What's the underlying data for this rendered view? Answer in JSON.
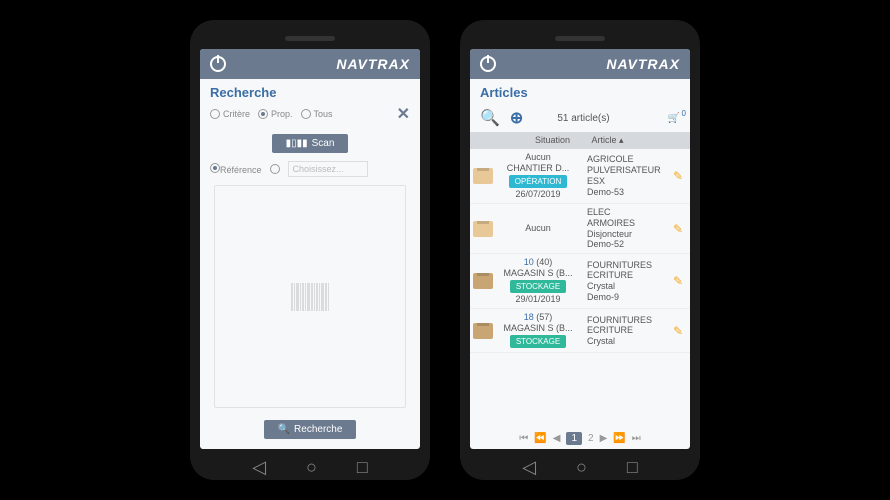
{
  "brand": "NAVTRAX",
  "left": {
    "title": "Recherche",
    "filters": {
      "critere": "Critère",
      "prop": "Prop.",
      "tous": "Tous"
    },
    "scan_btn": "Scan",
    "reference_label": "Référence",
    "select_placeholder": "Choisissez...",
    "search_btn": "Recherche"
  },
  "right": {
    "title": "Articles",
    "count": "51 article(s)",
    "cart_count": "0",
    "col_situation": "Situation",
    "col_article": "Article",
    "sort_indicator": "▴",
    "rows": [
      {
        "loc": "Aucun",
        "site": "CHANTIER D...",
        "tag": "OPÉRATION",
        "tag_class": "op",
        "date": "26/07/2019",
        "art1": "AGRICOLE",
        "art2": "PULVERISATEUR",
        "art3": "ESX",
        "art4": "Demo-53",
        "box": "open"
      },
      {
        "loc": "Aucun",
        "art1": "ELEC",
        "art2": "ARMOIRES",
        "art3": "Disjoncteur",
        "art4": "Demo-52",
        "box": "open"
      },
      {
        "qty1": "10",
        "qty2": "(40)",
        "site": "MAGASIN S (B...",
        "tag": "STOCKAGE",
        "tag_class": "st",
        "date": "29/01/2019",
        "art1": "FOURNITURES",
        "art2": "ECRITURE",
        "art3": "Crystal",
        "art4": "Demo-9",
        "box": "closed"
      },
      {
        "qty1": "18",
        "qty2": "(57)",
        "site": "MAGASIN S (B...",
        "tag": "STOCKAGE",
        "tag_class": "st",
        "art1": "FOURNITURES",
        "art2": "ECRITURE",
        "art3": "Crystal",
        "box": "closed"
      }
    ],
    "page_current": "1",
    "page_other": "2"
  }
}
